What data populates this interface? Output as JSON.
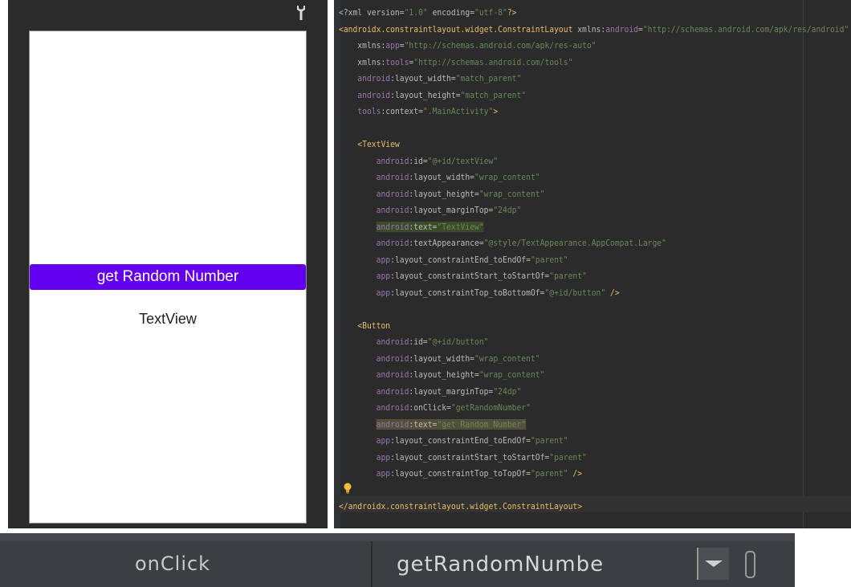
{
  "preview": {
    "button_label": "get Random Number",
    "textview_label": "TextView",
    "button_color": "#6200ee"
  },
  "editor": {
    "colors": {
      "background": "#2b2b2b",
      "tag": "#e8bf6a",
      "namespace": "#9876aa",
      "value": "#6a8759"
    },
    "lines": [
      [
        {
          "t": "<?xml version=",
          "c": "attr"
        },
        {
          "t": "\"1.0\"",
          "c": "val"
        },
        {
          "t": " encoding=",
          "c": "attr"
        },
        {
          "t": "\"utf-8\"",
          "c": "val"
        },
        {
          "t": "?>",
          "c": "tag"
        }
      ],
      [
        {
          "t": "<androidx.constraintlayout.widget.ConstraintLayout ",
          "c": "tag"
        },
        {
          "t": "xmlns:",
          "c": "attr"
        },
        {
          "t": "android",
          "c": "ns"
        },
        {
          "t": "=",
          "c": "attr"
        },
        {
          "t": "\"http://schemas.android.com/apk/res/android\"",
          "c": "val"
        }
      ],
      [
        {
          "t": "    xmlns:",
          "c": "attr"
        },
        {
          "t": "app",
          "c": "ns"
        },
        {
          "t": "=",
          "c": "attr"
        },
        {
          "t": "\"http://schemas.android.com/apk/res-auto\"",
          "c": "val"
        }
      ],
      [
        {
          "t": "    xmlns:",
          "c": "attr"
        },
        {
          "t": "tools",
          "c": "ns"
        },
        {
          "t": "=",
          "c": "attr"
        },
        {
          "t": "\"http://schemas.android.com/tools\"",
          "c": "val"
        }
      ],
      [
        {
          "t": "    android",
          "c": "ns"
        },
        {
          "t": ":layout_width=",
          "c": "attr"
        },
        {
          "t": "\"match_parent\"",
          "c": "val"
        }
      ],
      [
        {
          "t": "    android",
          "c": "ns"
        },
        {
          "t": ":layout_height=",
          "c": "attr"
        },
        {
          "t": "\"match_parent\"",
          "c": "val"
        }
      ],
      [
        {
          "t": "    tools",
          "c": "ns"
        },
        {
          "t": ":context=",
          "c": "attr"
        },
        {
          "t": "\".MainActivity\"",
          "c": "val"
        },
        {
          "t": ">",
          "c": "tag"
        }
      ],
      [],
      [
        {
          "t": "    <TextView",
          "c": "tag"
        }
      ],
      [
        {
          "t": "        android",
          "c": "ns"
        },
        {
          "t": ":id=",
          "c": "attr"
        },
        {
          "t": "\"@+id/textView\"",
          "c": "val"
        }
      ],
      [
        {
          "t": "        android",
          "c": "ns"
        },
        {
          "t": ":layout_width=",
          "c": "attr"
        },
        {
          "t": "\"wrap_content\"",
          "c": "val"
        }
      ],
      [
        {
          "t": "        android",
          "c": "ns"
        },
        {
          "t": ":layout_height=",
          "c": "attr"
        },
        {
          "t": "\"wrap_content\"",
          "c": "val"
        }
      ],
      [
        {
          "t": "        android",
          "c": "ns"
        },
        {
          "t": ":layout_marginTop=",
          "c": "attr"
        },
        {
          "t": "\"24dp\"",
          "c": "val"
        }
      ],
      [
        {
          "t": "        "
        },
        {
          "t": "android",
          "c": "ns hl"
        },
        {
          "t": ":text=",
          "c": "attr hl"
        },
        {
          "t": "\"TextView\"",
          "c": "val hl"
        }
      ],
      [
        {
          "t": "        android",
          "c": "ns"
        },
        {
          "t": ":textAppearance=",
          "c": "attr"
        },
        {
          "t": "\"@style/TextAppearance.AppCompat.Large\"",
          "c": "val"
        }
      ],
      [
        {
          "t": "        app",
          "c": "ns"
        },
        {
          "t": ":layout_constraintEnd_toEndOf=",
          "c": "attr"
        },
        {
          "t": "\"parent\"",
          "c": "val"
        }
      ],
      [
        {
          "t": "        app",
          "c": "ns"
        },
        {
          "t": ":layout_constraintStart_toStartOf=",
          "c": "attr"
        },
        {
          "t": "\"parent\"",
          "c": "val"
        }
      ],
      [
        {
          "t": "        app",
          "c": "ns"
        },
        {
          "t": ":layout_constraintTop_toBottomOf=",
          "c": "attr"
        },
        {
          "t": "\"@+id/button\"",
          "c": "val"
        },
        {
          "t": " />",
          "c": "tag"
        }
      ],
      [],
      [
        {
          "t": "    <Button",
          "c": "tag"
        }
      ],
      [
        {
          "t": "        android",
          "c": "ns"
        },
        {
          "t": ":id=",
          "c": "attr"
        },
        {
          "t": "\"@+id/button\"",
          "c": "val"
        }
      ],
      [
        {
          "t": "        android",
          "c": "ns"
        },
        {
          "t": ":layout_width=",
          "c": "attr"
        },
        {
          "t": "\"wrap_content\"",
          "c": "val"
        }
      ],
      [
        {
          "t": "        android",
          "c": "ns"
        },
        {
          "t": ":layout_height=",
          "c": "attr"
        },
        {
          "t": "\"wrap_content\"",
          "c": "val"
        }
      ],
      [
        {
          "t": "        android",
          "c": "ns"
        },
        {
          "t": ":layout_marginTop=",
          "c": "attr"
        },
        {
          "t": "\"24dp\"",
          "c": "val"
        }
      ],
      [
        {
          "t": "        android",
          "c": "ns"
        },
        {
          "t": ":onClick=",
          "c": "attr"
        },
        {
          "t": "\"getRandomNumber\"",
          "c": "val"
        }
      ],
      [
        {
          "t": "        "
        },
        {
          "t": "android",
          "c": "ns hl2"
        },
        {
          "t": ":text=",
          "c": "attr hl2"
        },
        {
          "t": "\"get Random Number\"",
          "c": "val hl2"
        }
      ],
      [
        {
          "t": "        app",
          "c": "ns"
        },
        {
          "t": ":layout_constraintEnd_toEndOf=",
          "c": "attr"
        },
        {
          "t": "\"parent\"",
          "c": "val"
        }
      ],
      [
        {
          "t": "        app",
          "c": "ns"
        },
        {
          "t": ":layout_constraintStart_toStartOf=",
          "c": "attr"
        },
        {
          "t": "\"parent\"",
          "c": "val"
        }
      ],
      [
        {
          "t": "        app",
          "c": "ns"
        },
        {
          "t": ":layout_constraintTop_toTopOf=",
          "c": "attr"
        },
        {
          "t": "\"parent\"",
          "c": "val"
        },
        {
          "t": " />",
          "c": "tag"
        }
      ],
      [],
      [
        {
          "t": "</androidx.constraintlayout.widget.ConstraintLayout>",
          "c": "tag"
        }
      ]
    ]
  },
  "attribute_row": {
    "name": "onClick",
    "value": "getRandomNumbe"
  },
  "icons": {
    "preview_toolbar": "wrench-icon",
    "editor_hint": "lightbulb-icon",
    "attribute_dropdown": "chevron-down-icon",
    "attribute_pick": "pick-resource-icon"
  }
}
